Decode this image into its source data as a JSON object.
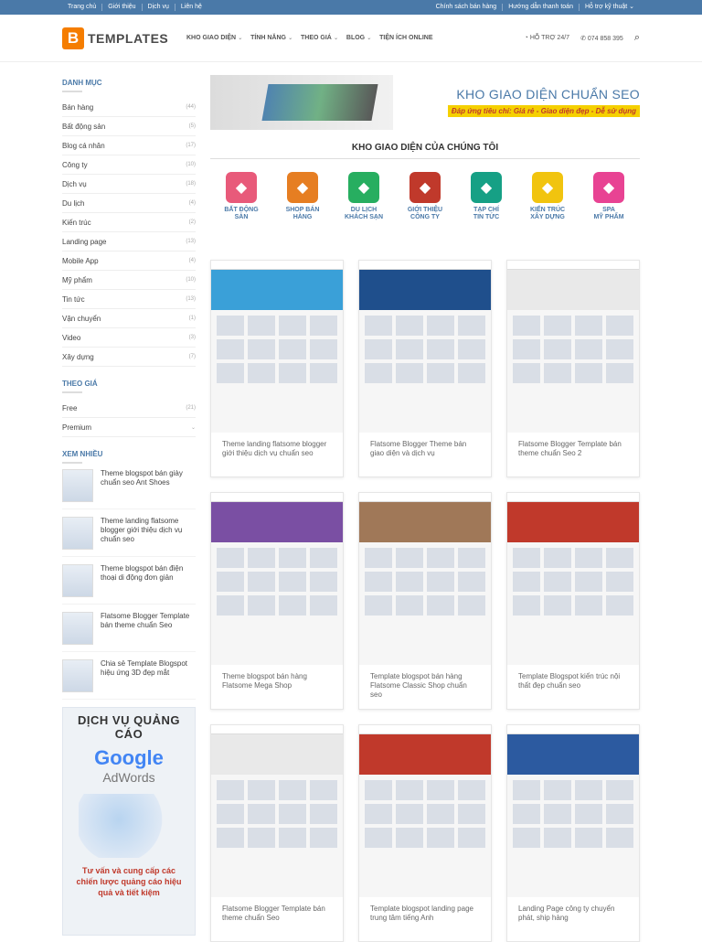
{
  "topbar": {
    "left": [
      "Trang chủ",
      "Giới thiệu",
      "Dịch vụ",
      "Liên hệ"
    ],
    "right": [
      "Chính sách bán hàng",
      "Hướng dẫn thanh toán",
      "Hỗ trợ kỹ thuật"
    ]
  },
  "header": {
    "logo_letter": "B",
    "logo_text": "TEMPLATES",
    "nav": [
      "KHO GIAO DIỆN",
      "TÍNH NĂNG",
      "THEO GIÁ",
      "BLOG",
      "TIỆN ÍCH ONLINE"
    ],
    "support": "HỖ TRỢ 24/7",
    "phone": "074 858 395"
  },
  "sidebar": {
    "cat_title": "DANH MỤC",
    "categories": [
      [
        "Bán hàng",
        "(44)"
      ],
      [
        "Bất động sản",
        "(5)"
      ],
      [
        "Blog cá nhân",
        "(17)"
      ],
      [
        "Công ty",
        "(10)"
      ],
      [
        "Dịch vụ",
        "(18)"
      ],
      [
        "Du lịch",
        "(4)"
      ],
      [
        "Kiến trúc",
        "(2)"
      ],
      [
        "Landing page",
        "(13)"
      ],
      [
        "Mobile App",
        "(4)"
      ],
      [
        "Mỹ phẩm",
        "(10)"
      ],
      [
        "Tin tức",
        "(13)"
      ],
      [
        "Vận chuyển",
        "(1)"
      ],
      [
        "Video",
        "(3)"
      ],
      [
        "Xây dựng",
        "(7)"
      ]
    ],
    "price_title": "THEO GIÁ",
    "prices": [
      [
        "Free",
        "(21)"
      ],
      [
        "Premium",
        ""
      ]
    ],
    "popular_title": "XEM NHIỀU",
    "popular": [
      "Theme blogspot bán giày chuẩn seo Ant Shoes",
      "Theme landing flatsome blogger giới thiệu dịch vụ chuẩn seo",
      "Theme blogspot bán điện thoại di động đơn giản",
      "Flatsome Blogger Template bán theme chuẩn Seo",
      "Chia sẻ Template Blogspot hiệu ứng 3D đẹp mắt"
    ],
    "ad": {
      "title": "DỊCH VỤ QUẢNG CÁO",
      "brand": "Google",
      "product": "AdWords",
      "desc": "Tư vấn và cung cấp các chiến lược quảng cáo hiệu quả và tiết kiệm"
    }
  },
  "banner": {
    "title": "KHO GIAO DIỆN CHUẨN SEO",
    "tagline": "Đáp ứng tiêu chí: Giá rẻ - Giao diện đẹp - Dễ sử dụng"
  },
  "section_title": "KHO GIAO DIỆN CỦA CHÚNG TÔI",
  "cats": [
    {
      "l1": "BẤT ĐỘNG",
      "l2": "SẢN",
      "color": "#e85a7a",
      "icon": "house-icon"
    },
    {
      "l1": "SHOP BÁN",
      "l2": "HÀNG",
      "color": "#e67e22",
      "icon": "shop-icon"
    },
    {
      "l1": "DU LỊCH",
      "l2": "KHÁCH SẠN",
      "color": "#27ae60",
      "icon": "map-icon"
    },
    {
      "l1": "GIỚI THIỆU",
      "l2": "CÔNG TY",
      "color": "#c0392b",
      "icon": "cafe-icon"
    },
    {
      "l1": "TẠP CHÍ",
      "l2": "TIN TỨC",
      "color": "#16a085",
      "icon": "city-icon"
    },
    {
      "l1": "KIẾN TRÚC",
      "l2": "XÂY DỰNG",
      "color": "#f1c40f",
      "icon": "construction-icon"
    },
    {
      "l1": "SPA",
      "l2": "MỸ PHẨM",
      "color": "#e84393",
      "icon": "flower-icon"
    }
  ],
  "cards": [
    {
      "caption": "Theme landing flatsome blogger giới thiệu dịch vụ chuẩn seo",
      "hero": "#3aa0d8"
    },
    {
      "caption": "Flatsome Blogger Theme bán giao diện và dịch vụ",
      "hero": "#1f4f8c"
    },
    {
      "caption": "Flatsome Blogger Template bán theme chuẩn Seo 2",
      "hero": "#e9e9e9"
    },
    {
      "caption": "Theme blogspot bán hàng Flatsome Mega Shop",
      "hero": "#7a4fa3"
    },
    {
      "caption": "Template blogspot bán hàng Flatsome Classic Shop chuẩn seo",
      "hero": "#a07858"
    },
    {
      "caption": "Template Blogspot kiến trúc nội thất đẹp chuẩn seo",
      "hero": "#c0392b"
    },
    {
      "caption": "Flatsome Blogger Template bán theme chuẩn Seo",
      "hero": "#e9e9e9"
    },
    {
      "caption": "Template blogspot landing page trung tâm tiếng Anh",
      "hero": "#c0392b"
    },
    {
      "caption": "Landing Page công ty chuyển phát, ship hàng",
      "hero": "#2c5aa0"
    }
  ]
}
